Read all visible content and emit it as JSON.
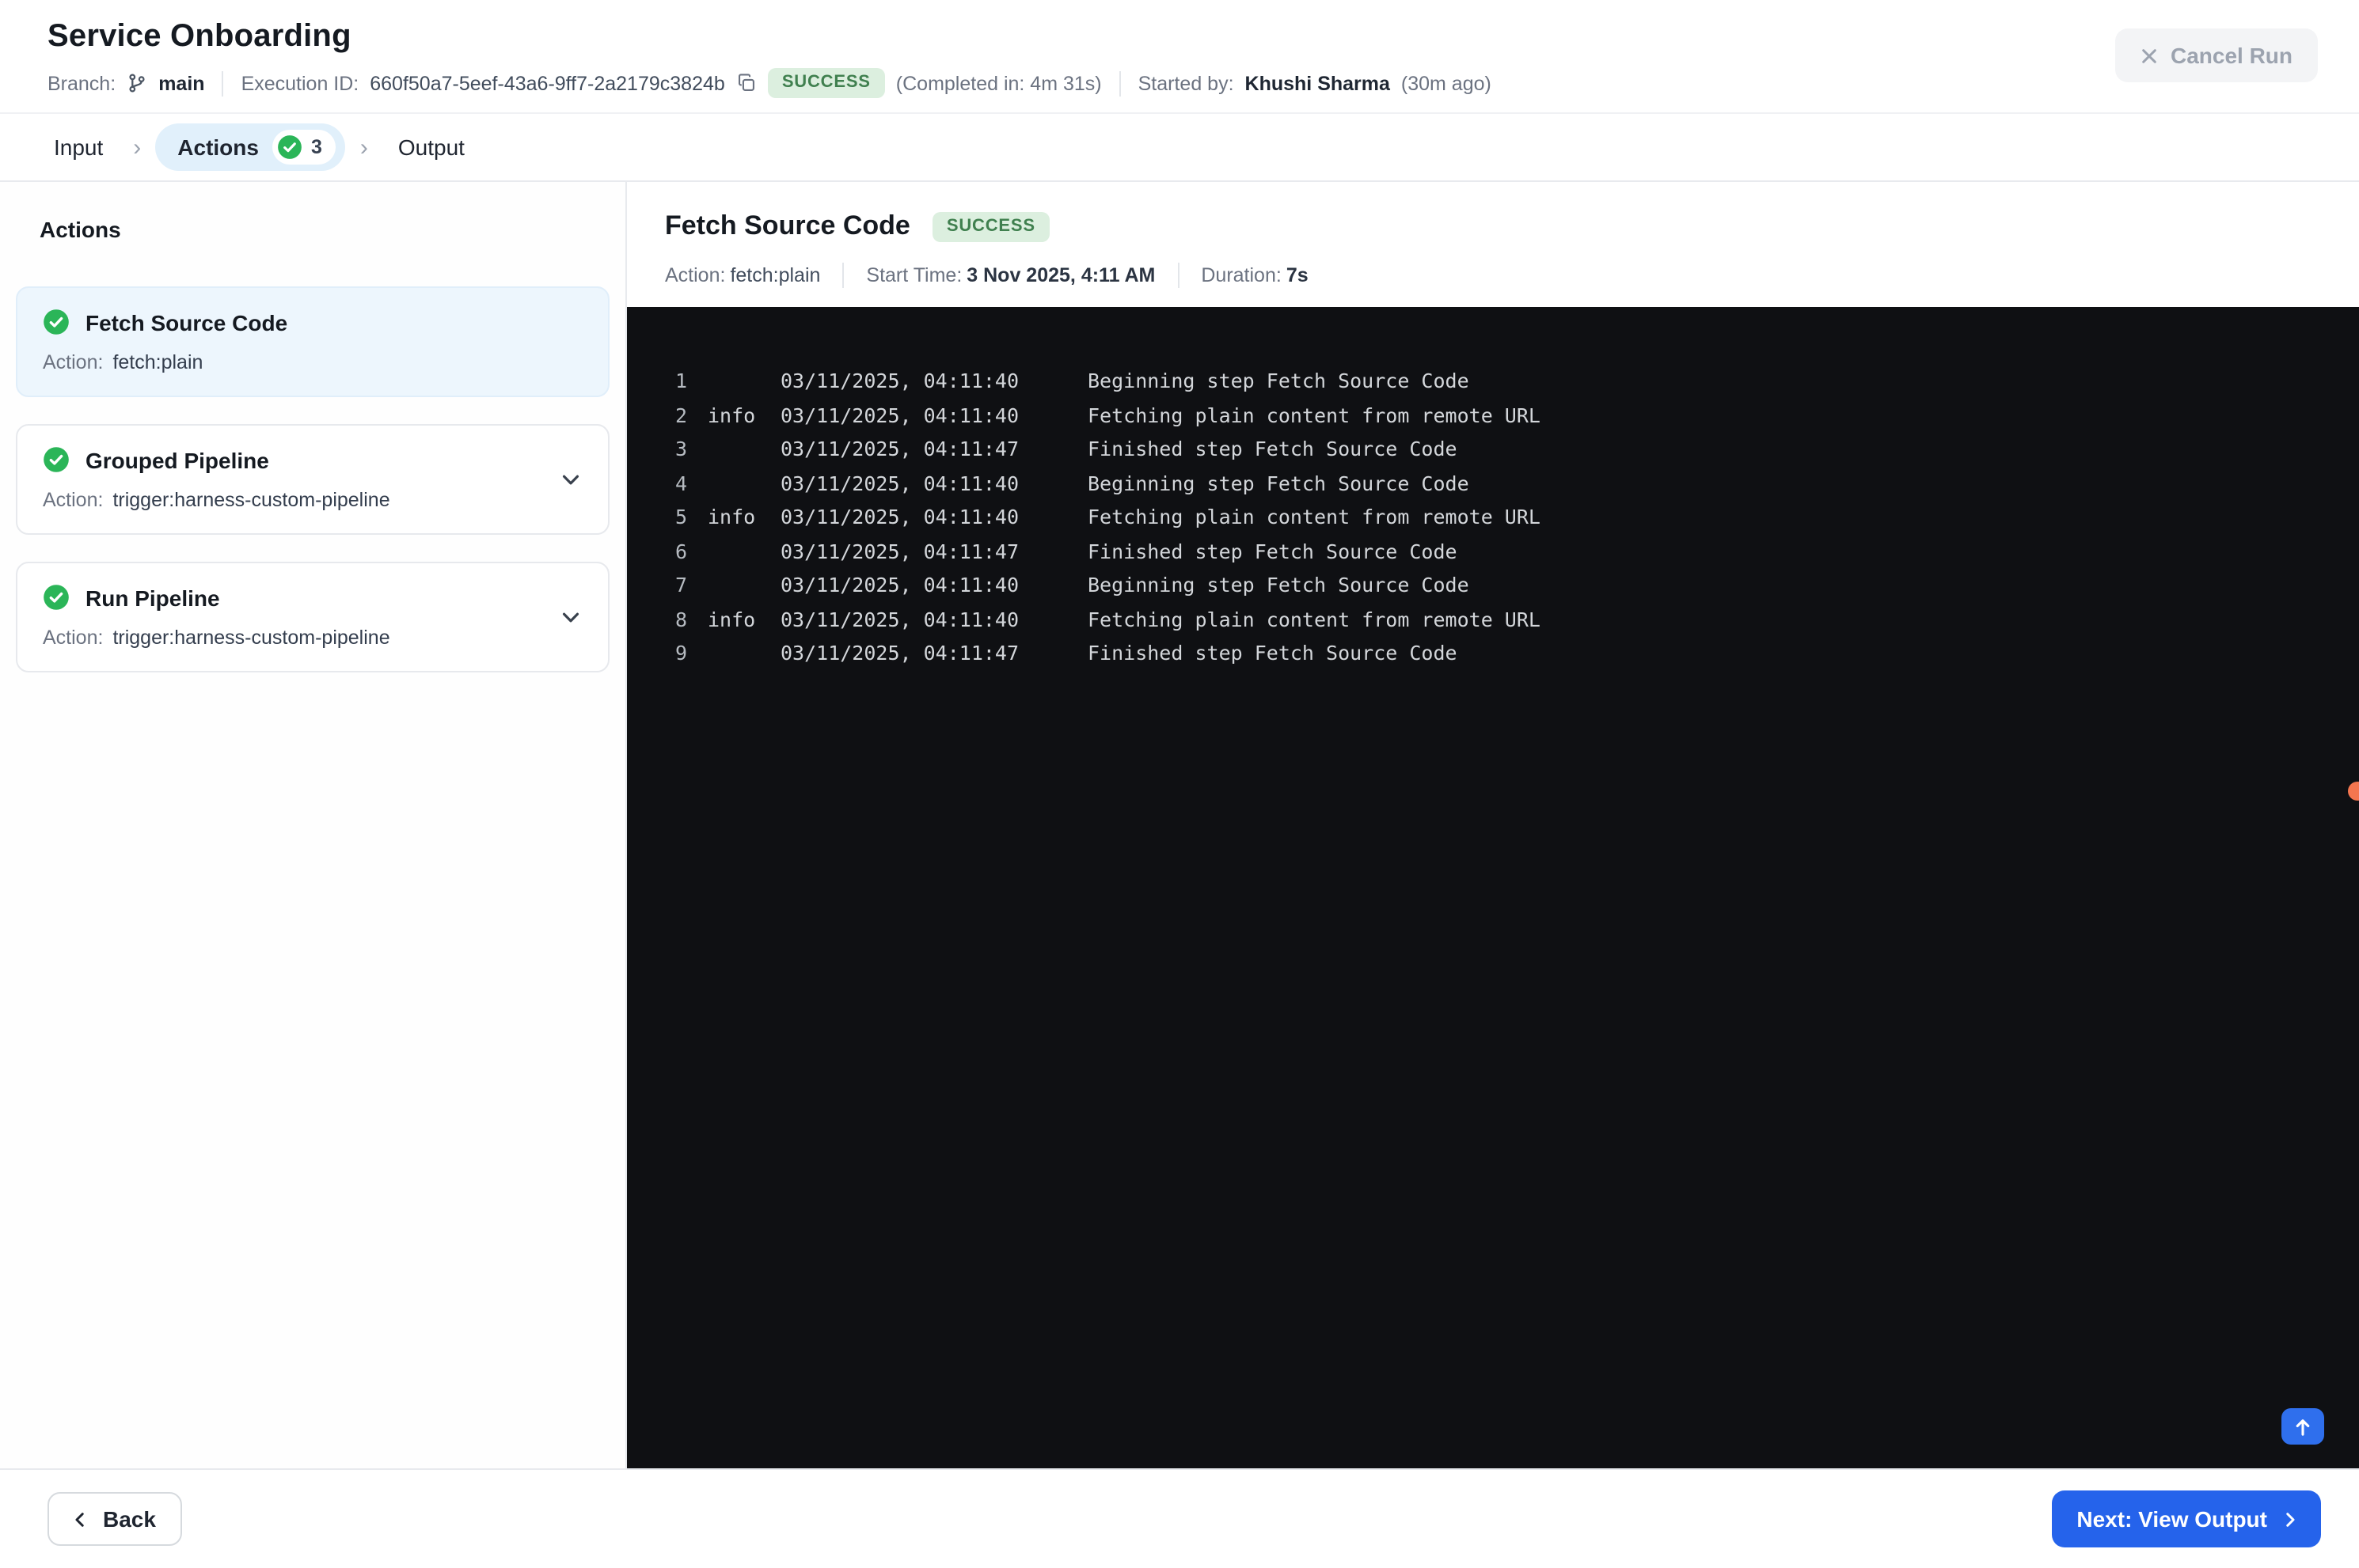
{
  "header": {
    "title": "Service Onboarding",
    "branch_label": "Branch:",
    "branch_name": "main",
    "execution_id_label": "Execution ID:",
    "execution_id": "660f50a7-5eef-43a6-9ff7-2a2179c3824b",
    "status_badge": "SUCCESS",
    "completed_in": "(Completed in: 4m 31s)",
    "started_by_label": "Started by:",
    "started_by_name": "Khushi Sharma",
    "started_by_ago": "(30m ago)",
    "cancel_run_label": "Cancel Run"
  },
  "stepper": {
    "steps": [
      {
        "label": "Input",
        "active": false,
        "count": ""
      },
      {
        "label": "Actions",
        "active": true,
        "count": "3"
      },
      {
        "label": "Output",
        "active": false,
        "count": ""
      }
    ]
  },
  "sidebar": {
    "title": "Actions",
    "action_label": "Action:",
    "items": [
      {
        "name": "Fetch Source Code",
        "action": "fetch:plain",
        "selected": true,
        "expandable": false
      },
      {
        "name": "Grouped Pipeline",
        "action": "trigger:harness-custom-pipeline",
        "selected": false,
        "expandable": true
      },
      {
        "name": "Run Pipeline",
        "action": "trigger:harness-custom-pipeline",
        "selected": false,
        "expandable": true
      }
    ]
  },
  "detail": {
    "title": "Fetch Source Code",
    "status_badge": "SUCCESS",
    "action_label": "Action:",
    "action_value": "fetch:plain",
    "start_time_label": "Start Time:",
    "start_time_value": "3 Nov 2025, 4:11 AM",
    "duration_label": "Duration:",
    "duration_value": "7s"
  },
  "console": {
    "lines": [
      {
        "num": "1",
        "tag": "",
        "time": "03/11/2025, 04:11:40",
        "msg": "Beginning step Fetch Source Code"
      },
      {
        "num": "2",
        "tag": "info",
        "time": "03/11/2025, 04:11:40",
        "msg": "Fetching plain content from remote URL"
      },
      {
        "num": "3",
        "tag": "",
        "time": "03/11/2025, 04:11:47",
        "msg": "Finished step Fetch Source Code"
      },
      {
        "num": "4",
        "tag": "",
        "time": "03/11/2025, 04:11:40",
        "msg": "Beginning step Fetch Source Code"
      },
      {
        "num": "5",
        "tag": "info",
        "time": "03/11/2025, 04:11:40",
        "msg": "Fetching plain content from remote URL"
      },
      {
        "num": "6",
        "tag": "",
        "time": "03/11/2025, 04:11:47",
        "msg": "Finished step Fetch Source Code"
      },
      {
        "num": "7",
        "tag": "",
        "time": "03/11/2025, 04:11:40",
        "msg": "Beginning step Fetch Source Code"
      },
      {
        "num": "8",
        "tag": "info",
        "time": "03/11/2025, 04:11:40",
        "msg": "Fetching plain content from remote URL"
      },
      {
        "num": "9",
        "tag": "",
        "time": "03/11/2025, 04:11:47",
        "msg": "Finished step Fetch Source Code"
      }
    ]
  },
  "footer": {
    "back_label": "Back",
    "next_label": "Next: View Output"
  },
  "colors": {
    "success_icon": "#2bb558",
    "success_badge_bg": "#dcefdf",
    "success_badge_text": "#40804f",
    "primary_blue": "#2563eb",
    "active_pill_bg": "#e1f0fb",
    "selected_card_bg": "#edf6fd",
    "console_bg": "#0f1013",
    "orange_dot": "#f4764f"
  }
}
